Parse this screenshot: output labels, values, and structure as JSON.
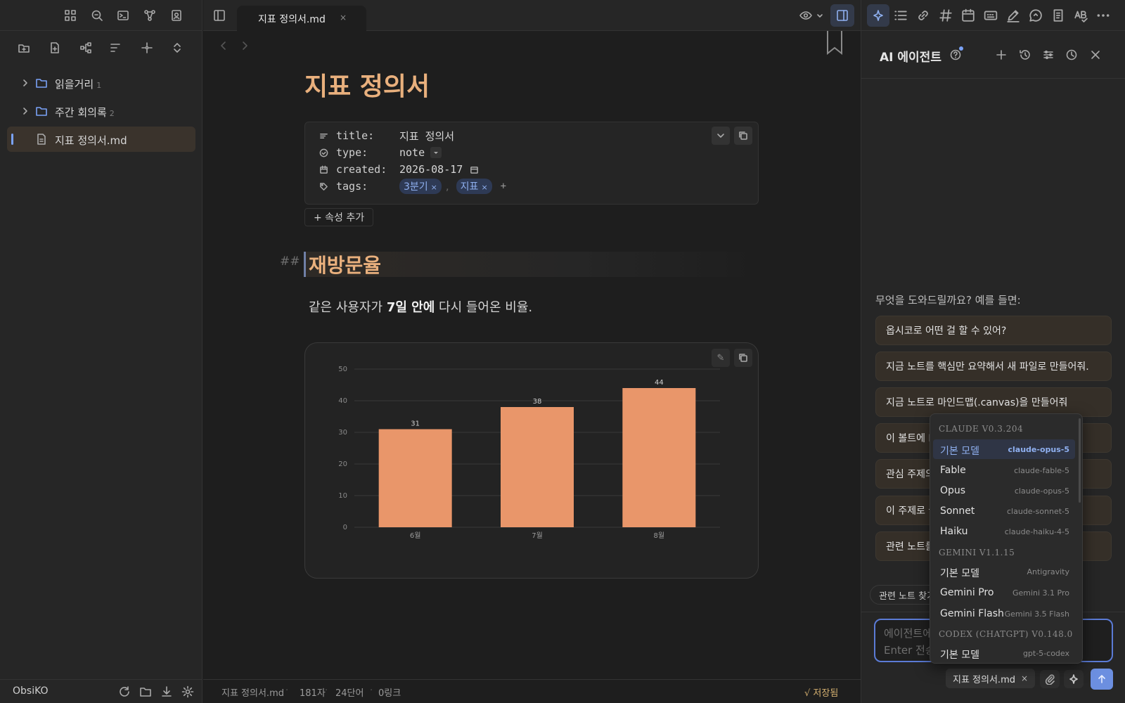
{
  "left_sidebar": {
    "top_icons": [
      "dashboard-icon",
      "search-zoom-icon",
      "terminal-icon",
      "graph-icon",
      "contact-card-icon"
    ],
    "action_icons": [
      "new-folder-icon",
      "new-note-icon",
      "workflow-icon",
      "sort-icon",
      "locate-icon",
      "expand-collapse-icon"
    ],
    "tree": [
      {
        "label": "읽을거리",
        "count": "1",
        "type": "folder"
      },
      {
        "label": "주간 회의록",
        "count": "2",
        "type": "folder"
      },
      {
        "label": "지표 정의서.md",
        "count": "",
        "type": "file"
      }
    ],
    "vault_name": "ObsiKO",
    "bottom_icons": [
      "refresh-icon",
      "folder-icon",
      "download-icon",
      "settings-icon"
    ]
  },
  "main": {
    "tab": {
      "title": "지표 정의서.md",
      "close": "×"
    },
    "doc_title": "지표 정의서",
    "properties": [
      {
        "key": "title:",
        "value": "지표 정의서",
        "icon": "text-lines-icon"
      },
      {
        "key": "type:",
        "value": "note",
        "icon": "circle-check-icon"
      },
      {
        "key": "created:",
        "value": "2026-08-17",
        "icon": "calendar-icon"
      },
      {
        "key": "tags:",
        "icon": "tag-icon",
        "tags": [
          "3분기",
          "지표"
        ],
        "separator": ","
      }
    ],
    "add_property": "+ 속성 추가",
    "heading_marker": "##",
    "heading": "재방문율",
    "paragraph": {
      "before": "같은 사용자가 ",
      "bold": "7일 안에",
      "after": " 다시 들어온 비율."
    },
    "chart_edit_glyph": "✎"
  },
  "chart_data": {
    "type": "bar",
    "categories": [
      "6월",
      "7월",
      "8월"
    ],
    "values": [
      31,
      38,
      44
    ],
    "ylim": [
      0,
      50
    ],
    "yticks": [
      0,
      10,
      20,
      30,
      40,
      50
    ],
    "bar_color": "#e9966a",
    "grid": true,
    "data_labels": true
  },
  "status_bar": {
    "file": "지표 정의서.md",
    "chars": "181자",
    "words": "24단어",
    "links": "0링크",
    "saved": "√ 저장됨"
  },
  "right_panel": {
    "top_icons": [
      "sparkle-icon",
      "list-icon",
      "link-icon",
      "hash-icon",
      "calendar-icon",
      "keyboard-icon",
      "pen-icon",
      "chat-icon",
      "document-icon",
      "spellcheck-icon",
      "more-icon"
    ],
    "agent_title": "AI 에이전트",
    "header_icons": [
      "plus-icon",
      "history-icon",
      "sliders-icon",
      "clock-icon",
      "close-icon"
    ],
    "intro": "무엇을 도와드릴까요? 예를 들면:",
    "suggestions": [
      "옵시코로 어떤 걸 할 수 있어?",
      "지금 노트를 핵심만 요약해서 새 파일로 만들어줘.",
      "지금 노트로 마인드맵(.canvas)을 만들어줘",
      "이 볼트에 L",
      "관심 주제의",
      "이 주제로 글",
      "관련 노트를"
    ],
    "chip": "관련 노트 찾기",
    "input_placeholder_1": "에이전트에",
    "input_placeholder_2": "Enter 전송",
    "context_chip": "지표 정의서.md",
    "context_chip_close": "×",
    "model_menu": {
      "groups": [
        {
          "title": "CLAUDE  V0.3.204",
          "items": [
            {
              "name": "기본 모델",
              "value": "claude-opus-5",
              "selected": true
            },
            {
              "name": "Fable",
              "value": "claude-fable-5"
            },
            {
              "name": "Opus",
              "value": "claude-opus-5"
            },
            {
              "name": "Sonnet",
              "value": "claude-sonnet-5"
            },
            {
              "name": "Haiku",
              "value": "claude-haiku-4-5"
            }
          ]
        },
        {
          "title": "GEMINI  V1.1.15",
          "items": [
            {
              "name": "기본 모델",
              "value": "Antigravity"
            },
            {
              "name": "Gemini Pro",
              "value": "Gemini 3.1 Pro"
            },
            {
              "name": "Gemini Flash",
              "value": "Gemini 3.5 Flash"
            }
          ]
        },
        {
          "title": "CODEX (CHATGPT)  V0.148.0",
          "items": [
            {
              "name": "기본 모델",
              "value": "gpt-5-codex"
            }
          ]
        }
      ]
    }
  },
  "colors": {
    "accent": "#7aa2f7",
    "heading": "#e9b07d",
    "bar": "#e9966a",
    "send": "#6c8fe0"
  }
}
